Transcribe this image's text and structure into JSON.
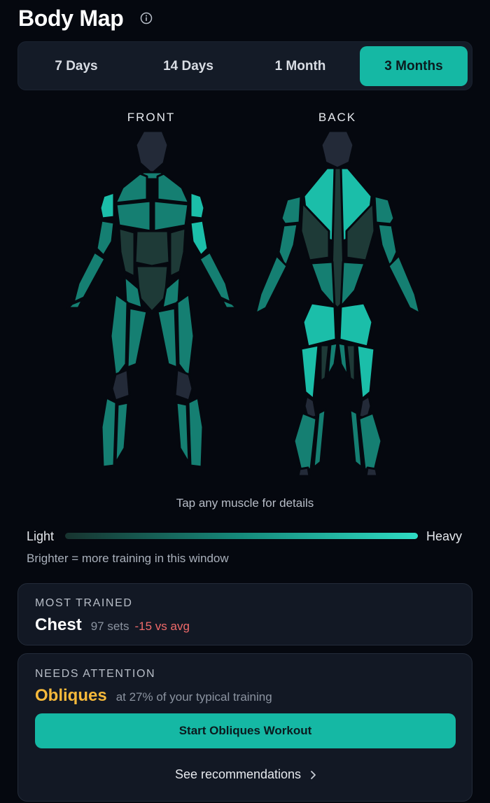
{
  "header": {
    "title": "Body Map",
    "info_icon": "info-circle-icon"
  },
  "range_tabs": [
    {
      "label": "7 Days",
      "selected": false
    },
    {
      "label": "14 Days",
      "selected": false
    },
    {
      "label": "1 Month",
      "selected": false
    },
    {
      "label": "3 Months",
      "selected": true
    }
  ],
  "body_map": {
    "front_label": "FRONT",
    "back_label": "BACK",
    "hint": "Tap any muscle for details",
    "colors": {
      "head": "#232a38",
      "low": "#1e3a37",
      "mid": "#157f72",
      "high": "#1bbea9",
      "untrained": "#232a38",
      "outline": "#05080f"
    }
  },
  "legend": {
    "light_label": "Light",
    "heavy_label": "Heavy",
    "note": "Brighter = more training in this window"
  },
  "most_trained": {
    "kicker": "MOST TRAINED",
    "muscle": "Chest",
    "sets": "97 sets",
    "delta": "-15 vs avg"
  },
  "needs_attention": {
    "kicker": "NEEDS ATTENTION",
    "muscle": "Obliques",
    "detail": "at 27% of your typical training",
    "cta_label": "Start Obliques Workout",
    "link_label": "See recommendations"
  },
  "theme": {
    "accent": "#15b8a4",
    "warning": "#f6b93b",
    "negative": "#f06a6a",
    "background": "#05080f",
    "card": "#121824"
  }
}
